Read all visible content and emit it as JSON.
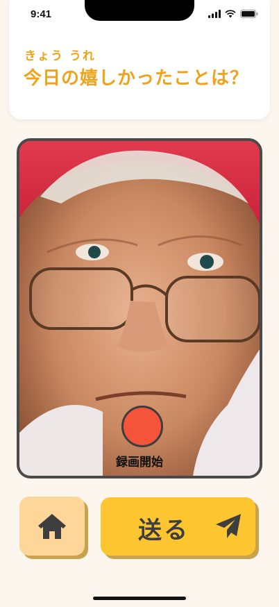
{
  "status_bar": {
    "time": "9:41"
  },
  "header": {
    "furigana": "きょう うれ",
    "question": "今日の嬉しかったことは？"
  },
  "camera": {
    "record_label": "録画開始",
    "record_color": "#F4553A"
  },
  "actions": {
    "home_icon": "home-icon",
    "send_label": "送る",
    "send_icon": "paper-plane-icon"
  },
  "colors": {
    "accent": "#F0A21A",
    "home_button": "#FFD69A",
    "send_button": "#FDC52F",
    "background": "#FDF6EF"
  }
}
